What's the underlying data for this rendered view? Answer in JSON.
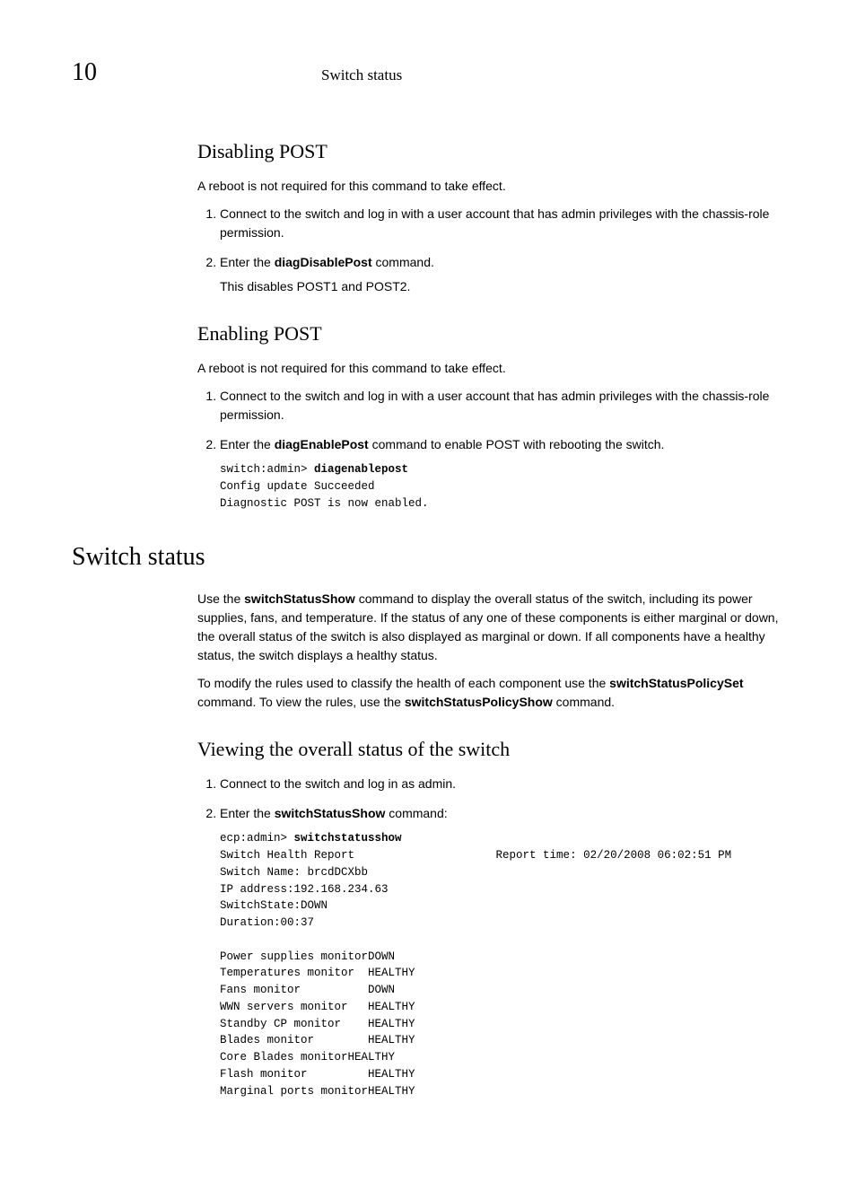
{
  "header": {
    "pageNumber": "10",
    "title": "Switch status"
  },
  "disablingPost": {
    "heading": "Disabling POST",
    "intro": "A reboot is not required for this command to take effect.",
    "step1": "Connect to the switch and log in with a user account that has admin privileges with the chassis-role permission.",
    "step2_pre": "Enter the ",
    "step2_cmd": "diagDisablePost",
    "step2_post": " command.",
    "step2_sub": "This disables POST1 and POST2."
  },
  "enablingPost": {
    "heading": "Enabling POST",
    "intro": "A reboot is not required for this command to take effect.",
    "step1": "Connect to the switch and log in with a user account that has admin privileges with the chassis-role permission.",
    "step2_pre": "Enter the ",
    "step2_cmd": "diagEnablePost",
    "step2_post": " command to enable POST with rebooting the switch.",
    "code_prompt": "switch:admin> ",
    "code_cmd": "diagenablepost",
    "code_output": "Config update Succeeded\nDiagnostic POST is now enabled."
  },
  "switchStatus": {
    "heading": "Switch status",
    "para1_pre": "Use the ",
    "para1_cmd": "switchStatusShow",
    "para1_post": " command to display the overall status of the switch, including its power supplies, fans, and temperature. If the status of any one of these components is either marginal or down, the overall status of the switch is also displayed as marginal or down. If all components have a healthy status, the switch displays a healthy status.",
    "para2_pre": "To modify the rules used to classify the health of each component use the ",
    "para2_cmd1": "switchStatusPolicySet",
    "para2_mid": " command. To view the rules, use the ",
    "para2_cmd2": "switchStatusPolicyShow",
    "para2_post": " command."
  },
  "viewing": {
    "heading": "Viewing the overall status of the switch",
    "step1": "Connect to the switch and log in as admin.",
    "step2_pre": "Enter the ",
    "step2_cmd": "switchStatusShow",
    "step2_post": " command:",
    "code_prompt": "ecp:admin> ",
    "code_cmd": "switchstatusshow",
    "code_output": "Switch Health Report                     Report time: 02/20/2008 06:02:51 PM\nSwitch Name: brcdDCXbb\nIP address:192.168.234.63\nSwitchState:DOWN\nDuration:00:37\n\nPower supplies monitorDOWN\nTemperatures monitor  HEALTHY\nFans monitor          DOWN\nWWN servers monitor   HEALTHY\nStandby CP monitor    HEALTHY\nBlades monitor        HEALTHY\nCore Blades monitorHEALTHY\nFlash monitor         HEALTHY\nMarginal ports monitorHEALTHY"
  }
}
